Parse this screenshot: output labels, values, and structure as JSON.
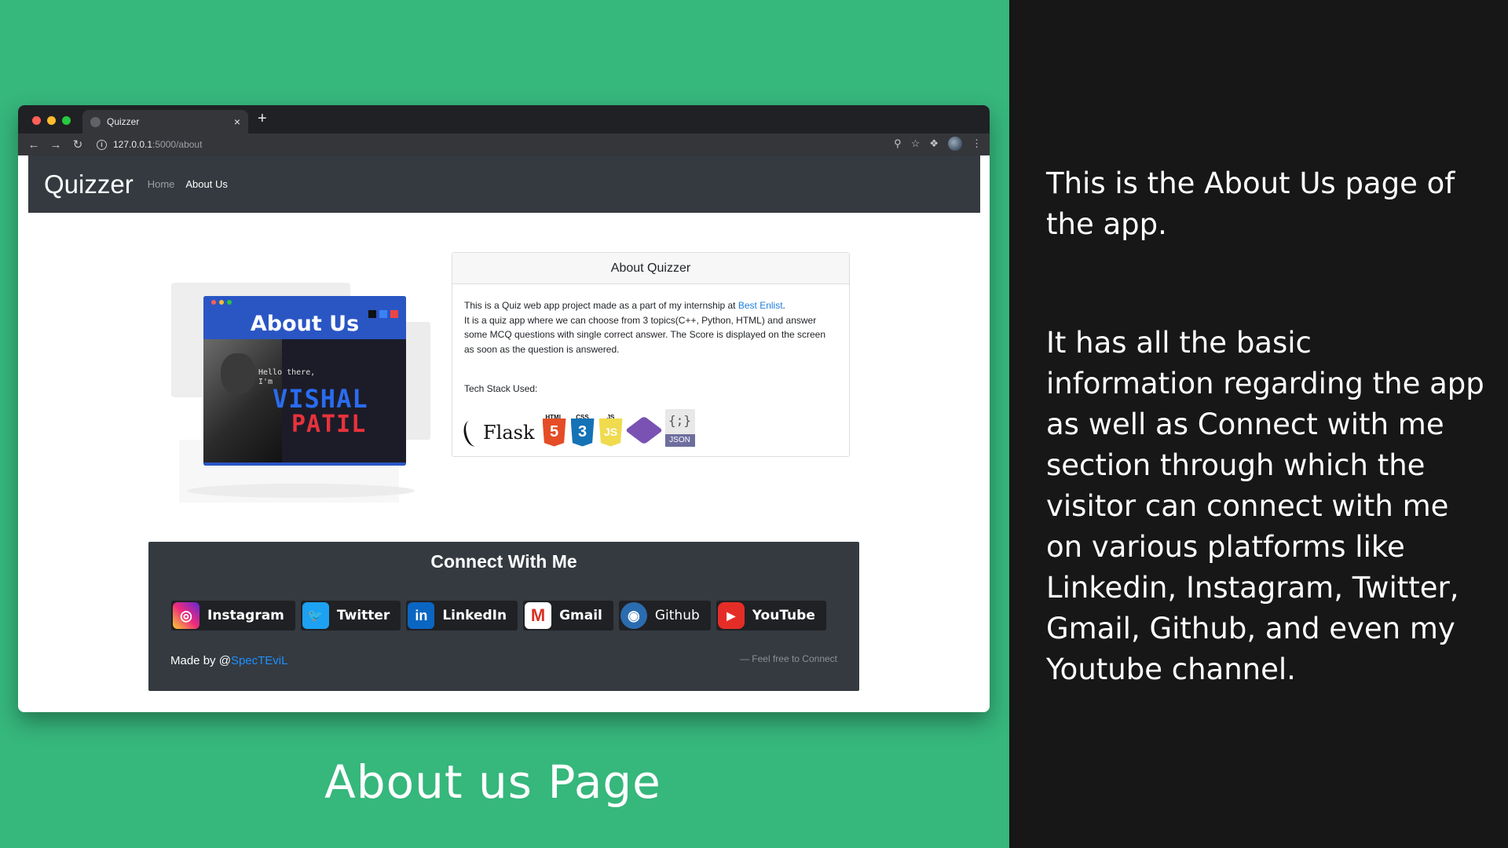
{
  "slide": {
    "caption": "About us Page",
    "description_1": "This is the About Us page of the app.",
    "description_2": "It has all the basic information regarding the app as well as Connect with me section through which the visitor can connect with me on various platforms like Linkedin, Instagram, Twitter, Gmail, Github, and even my Youtube channel.",
    "colors": {
      "green": "#36b77c",
      "dark": "#171717"
    }
  },
  "browser": {
    "tab_title": "Quizzer",
    "tab_close": "×",
    "new_tab": "+",
    "url_host": "127.0.0.1",
    "url_path": ":5000/about",
    "icons": [
      "back-arrow-icon",
      "forward-arrow-icon",
      "reload-icon",
      "info-icon",
      "zoom-icon",
      "star-icon",
      "extensions-icon",
      "profile-icon",
      "menu-icon"
    ]
  },
  "site": {
    "brand": "Quizzer",
    "nav": {
      "home": "Home",
      "about": "About Us"
    },
    "illustration": {
      "title": "About Us",
      "hello_line1": "Hello there,",
      "hello_line2": "I'm",
      "first_name": "VISHAL",
      "last_name": "PATIL"
    },
    "about_card": {
      "header": "About Quizzer",
      "intro_before_link": "This is a Quiz web app project made as a part of my internship at ",
      "link_text": "Best Enlist",
      "intro_after_link": ".",
      "line2": "It is a quiz app where we can choose from 3 topics(C++, Python, HTML) and answer some MCQ questions with single correct answer. The Score is displayed on the screen as soon as the question is answered.",
      "tech_label": "Tech Stack Used:",
      "tech": {
        "flask": "Flask",
        "html_label": "HTML",
        "html_glyph": "5",
        "css_label": "CSS",
        "css_glyph": "3",
        "js_label": "JS",
        "js_glyph": "JS",
        "json_braces": "{;}",
        "json_tag": "JSON"
      }
    },
    "connect": {
      "title": "Connect With Me",
      "buttons": [
        {
          "label": "Instagram",
          "glyph": "◎"
        },
        {
          "label": "Twitter",
          "glyph": "🐦"
        },
        {
          "label": "LinkedIn",
          "glyph": "in"
        },
        {
          "label": "Gmail",
          "glyph": "M"
        },
        {
          "label": "Github",
          "glyph": "◉"
        },
        {
          "label": "YouTube",
          "glyph": "▶"
        }
      ],
      "made_by_prefix": "Made by @",
      "made_by_handle": "SpecTEviL",
      "feel_free": "— Feel free to Connect"
    }
  }
}
